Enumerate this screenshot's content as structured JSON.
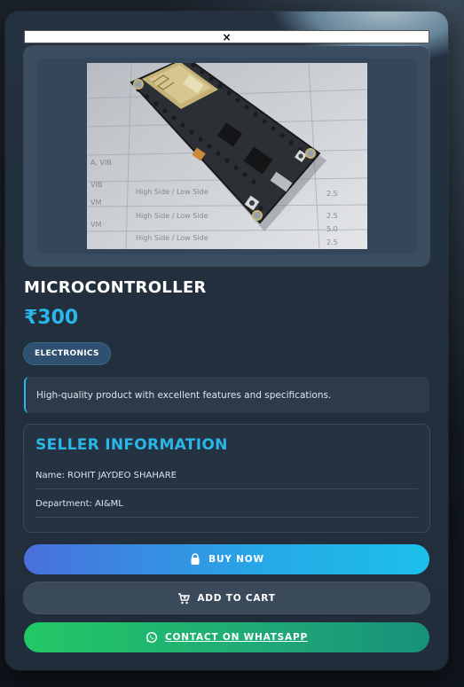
{
  "modal": {
    "close_label": "×"
  },
  "product": {
    "title": "MICROCONTROLLER",
    "price": "₹300",
    "category": "ELECTRONICS",
    "description": "High-quality product with excellent features and specifications.",
    "image_icon": "product-photo-microcontroller-board"
  },
  "seller": {
    "heading": "SELLER INFORMATION",
    "name_line": "Name: ROHIT JAYDEO SHAHARE",
    "department_line": "Department: AI&ML"
  },
  "actions": {
    "buy_label": "BUY NOW",
    "buy_icon": "shopping-bag-icon",
    "cart_label": "ADD TO CART",
    "cart_icon": "cart-plus-icon",
    "whatsapp_label": "CONTACT ON WHATSAPP",
    "whatsapp_icon": "whatsapp-icon"
  },
  "colors": {
    "accent": "#29b6e8",
    "card_bg": "#243140",
    "buy_gradient_start": "#4a6fdc",
    "buy_gradient_end": "#1cc0ea",
    "whatsapp_green": "#22c865"
  }
}
